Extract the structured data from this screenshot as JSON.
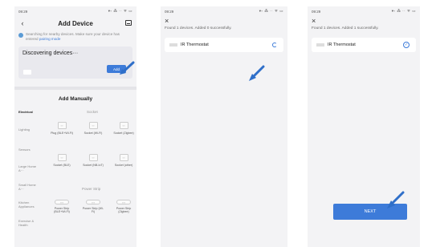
{
  "screen1": {
    "status": {
      "time": "09:29",
      "icons": "▾▫ ⁂ ·· ᯤ ▭"
    },
    "title": "Add Device",
    "hint_text": "Searching for nearby devices. Make sure your device has entered ",
    "hint_link": "pairing mode",
    "discover_label": "Discovering devices···",
    "add_label": "Add",
    "manual_title": "Add Manually",
    "categories": [
      "Electrical",
      "Lighting",
      "Sensors",
      "Large Home A···",
      "Small Home A···",
      "Kitchen Appliances",
      "Exercise & Health"
    ],
    "socket_header": "Socket",
    "power_strip_header": "Power Strip",
    "devices": [
      {
        "label": "Plug (BLE+Wi-Fi)"
      },
      {
        "label": "Socket (Wi-Fi)"
      },
      {
        "label": "Socket (Zigbee)"
      },
      {
        "label": "Socket (BLE)"
      },
      {
        "label": "Socket (NB-IoT)"
      },
      {
        "label": "Socket (other)"
      },
      {
        "label": "Power Strip (BLE+Wi-Fi)"
      },
      {
        "label": "Power Strip (Wi-Fi)"
      },
      {
        "label": "Power Strip (Zigbee)"
      }
    ]
  },
  "screen2": {
    "status": {
      "time": "09:29",
      "icons": "▾▫ ⁂ ·· ᯤ ▭"
    },
    "found_text": "Found 1 devices. Added 0 successfully.",
    "device_name": "IR Thermostat"
  },
  "screen3": {
    "status": {
      "time": "09:29",
      "icons": "▾▫ ⁂ ·· ᯤ ▭"
    },
    "found_text": "Found 1 devices. Added 1 successfully.",
    "device_name": "IR Thermostat",
    "next_label": "NEXT"
  },
  "colors": {
    "accent": "#3d7bd9",
    "arrow": "#2f6fc9"
  }
}
